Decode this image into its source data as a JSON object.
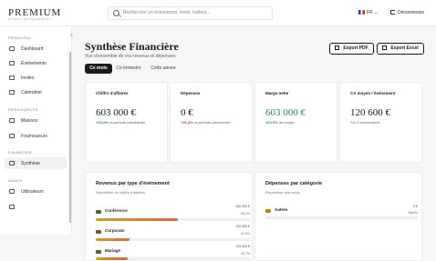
{
  "header": {
    "logo": "PREMIUM",
    "logo_sub": "EVENT MANAGEMENT",
    "search_placeholder": "Rechercher un événement, invité, traiteur...",
    "language": "FR",
    "logout_label": "Déconnexion"
  },
  "sidebar": {
    "sections": [
      {
        "label": "PRINCIPAL",
        "items": [
          {
            "label": "Dashboard",
            "icon": "dashboard-icon"
          },
          {
            "label": "Événements",
            "icon": "calendar-icon"
          },
          {
            "label": "Invités",
            "icon": "users-icon"
          },
          {
            "label": "Calendrier",
            "icon": "calendar-icon"
          }
        ]
      },
      {
        "label": "RESSOURCES",
        "items": [
          {
            "label": "Maisons",
            "icon": "building-icon"
          },
          {
            "label": "Fournisseurs",
            "icon": "truck-icon"
          }
        ]
      },
      {
        "label": "FINANCIER",
        "items": [
          {
            "label": "Synthèse",
            "icon": "chart-icon",
            "active": true
          }
        ]
      },
      {
        "label": "ADMIN",
        "items": [
          {
            "label": "Utilisateurs",
            "icon": "user-icon"
          }
        ]
      }
    ]
  },
  "page": {
    "title": "Synthèse Financière",
    "subtitle": "Vue d'ensemble de vos revenus et dépenses",
    "tabs": [
      {
        "label": "Ce mois",
        "active": true
      },
      {
        "label": "Ce trimestre"
      },
      {
        "label": "Cette année"
      }
    ],
    "export_pdf": "Export PDF",
    "export_excel": "Export Excel"
  },
  "cards": [
    {
      "label": "Chiffre d'affaires",
      "value": "603 000 €",
      "change": "+23,1%",
      "change_text": "vs période précédente"
    },
    {
      "label": "Dépenses",
      "value": "0 €",
      "change": "+16,4%",
      "change_text": "vs période précédente"
    },
    {
      "label": "Marge nette",
      "value": "603 000 €",
      "change": "100.0%",
      "change_text": "de marge"
    },
    {
      "label": "CA moyen / événement",
      "value": "120 600 €",
      "change": "",
      "change_text": "Sur 5 événements"
    }
  ],
  "revenue_panel": {
    "title": "Revenus par type d'événement",
    "subtitle": "Répartition du chiffre d'affaires",
    "rows": [
      {
        "name": "Conférence",
        "amount": "320 000 €",
        "percent": "53.1%",
        "fraction": 0.531
      },
      {
        "name": "Corporate",
        "amount": "130 000 €",
        "percent": "21.6%",
        "fraction": 0.216
      },
      {
        "name": "Mariage",
        "amount": "125 000 €",
        "percent": "20.7%",
        "fraction": 0.207
      }
    ]
  },
  "expense_panel": {
    "title": "Dépenses par catégorie",
    "subtitle": "Répartition des coûts",
    "rows": [
      {
        "name": "Autres",
        "amount": "0 €",
        "percent": "NaN%",
        "fraction": 0
      }
    ]
  }
}
